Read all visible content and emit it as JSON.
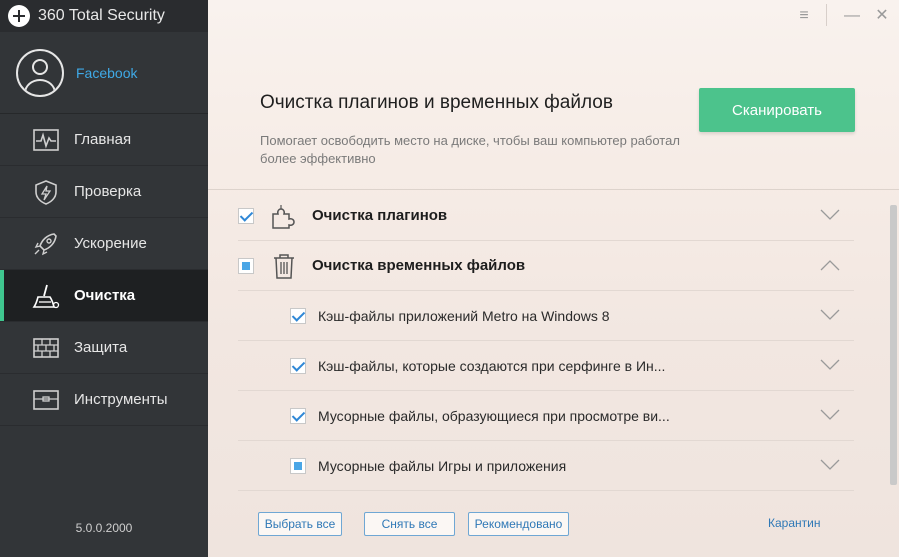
{
  "app": {
    "title": "360 Total Security",
    "version": "5.0.0.2000"
  },
  "account": {
    "name": "Facebook"
  },
  "sidebar": {
    "items": [
      {
        "label": "Главная",
        "icon": "heartbeat-icon",
        "active": false
      },
      {
        "label": "Проверка",
        "icon": "shield-icon",
        "active": false
      },
      {
        "label": "Ускорение",
        "icon": "rocket-icon",
        "active": false
      },
      {
        "label": "Очистка",
        "icon": "broom-icon",
        "active": true
      },
      {
        "label": "Защита",
        "icon": "firewall-icon",
        "active": false
      },
      {
        "label": "Инструменты",
        "icon": "toolbox-icon",
        "active": false
      }
    ]
  },
  "window_controls": {
    "menu": "≡",
    "minimize": "—",
    "close": "✕"
  },
  "main": {
    "title": "Очистка плагинов и временных файлов",
    "description": "Помогает освободить место на диске, чтобы ваш компьютер работал более эффективно",
    "scan_button": "Сканировать"
  },
  "list": {
    "sections": [
      {
        "label": "Очистка плагинов",
        "icon": "puzzle-icon",
        "state": "checked",
        "expanded": false
      },
      {
        "label": "Очистка временных файлов",
        "icon": "trash-icon",
        "state": "partial",
        "expanded": true
      }
    ],
    "sub_items": [
      {
        "label": "Кэш-файлы приложений Metro на Windows 8",
        "state": "checked"
      },
      {
        "label": "Кэш-файлы, которые создаются при серфинге в Ин...",
        "state": "checked"
      },
      {
        "label": "Мусорные файлы, образующиеся при просмотре ви...",
        "state": "checked"
      },
      {
        "label": "Мусорные файлы Игры и приложения",
        "state": "partial"
      }
    ]
  },
  "footer": {
    "select_all": "Выбрать все",
    "deselect_all": "Снять все",
    "recommended": "Рекомендовано",
    "quarantine": "Карантин"
  },
  "colors": {
    "accent": "#4cc38c",
    "link": "#2f78b6",
    "sidebar": "#323538"
  }
}
